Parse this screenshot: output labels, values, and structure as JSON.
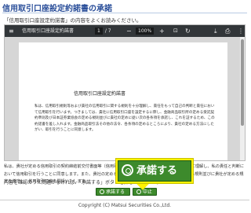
{
  "page": {
    "title": "信用取引口座設定約諾書の承諾",
    "instruction": "「信用取引口座設定約諾書」の内容をよくお読みください。"
  },
  "viewer": {
    "toolbar": {
      "menu_icon": "≡",
      "file_name": "信用取引口座設定約諾書",
      "page_current": "1",
      "page_total": "/ 7",
      "zoom_out": "−",
      "zoom": "100%",
      "zoom_in": "+",
      "fit_icon": "⊡",
      "rotate_icon": "↻",
      "download_icon": "⤓",
      "print_icon": "⎙",
      "more_icon": "⋮"
    },
    "document": {
      "title": "信用取引口座設定約諾書",
      "body": "私は、信用取引規則等および貴社の信用取引に関する規則を十分理解し、責任をもって自己の判断と責任において信用取引を行います。つきましては、貴社に信用取引口座を設定するに際し、金融商品取引所の定める受託契約準則及び日本証券業協会の定める規則並びに貴社の定めに従い次の各条項を承諾し、これを証するため、この約諾書を差し入れます。金融商品取引法その他の法令、各条項の定めるところにより、貴社の定める方法にしたがい、取引を行うことに同意します。"
    }
  },
  "consent_text": "私は、貴社が定める信用取引の契約締結前交付書面等（信用取引口座設定約諾書を含む）の内容を十分に理解し、私の責任と判断において信用取引を行うことに同意します。また、貴社の定める取引ルールおよび金融商品取引所の定める規則並びに貴社が定める規定を遵守し、信用取引口座を開設いたします。",
  "action_prompt": "内容を確認のうえ問題がなければ、「承諾する」ボタンを押してください。",
  "buttons": {
    "accept_large": "承諾する",
    "accept_small": "承諾する",
    "cancel_small": "中止"
  },
  "footer": {
    "copyright": "Copyright (C) Matsui Securities Co.,Ltd."
  },
  "colors": {
    "title_blue": "#2b4f9a",
    "button_green": "#3d8a2c",
    "callout_yellow": "#fff200",
    "toolbar_dark": "#323639"
  }
}
